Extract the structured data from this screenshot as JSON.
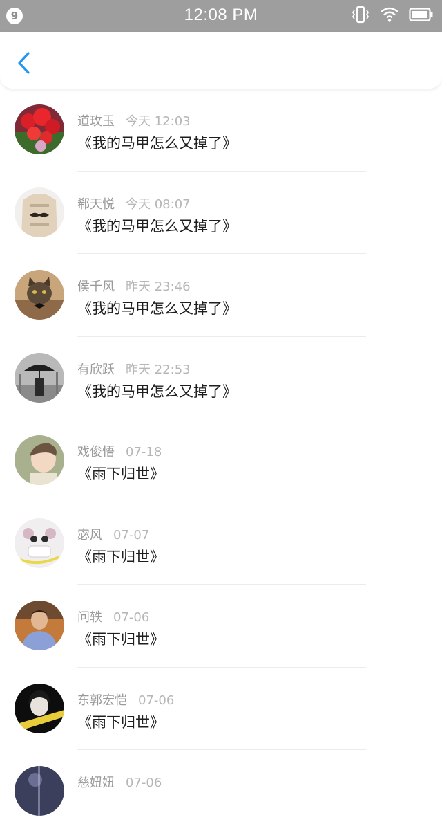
{
  "status_bar": {
    "notification_count": "9",
    "time": "12:08 PM"
  },
  "header": {
    "back_icon": "chevron-left-icon",
    "accent_color": "#2196f3"
  },
  "items": [
    {
      "name": "道玫玉",
      "time": "今天 12:03",
      "title": "《我的马甲怎么又掉了》"
    },
    {
      "name": "郗天悦",
      "time": "今天 08:07",
      "title": "《我的马甲怎么又掉了》"
    },
    {
      "name": "侯千风",
      "time": "昨天 23:46",
      "title": "《我的马甲怎么又掉了》"
    },
    {
      "name": "有欣跃",
      "time": "昨天 22:53",
      "title": "《我的马甲怎么又掉了》"
    },
    {
      "name": "戏俊悟",
      "time": "07-18",
      "title": "《雨下归世》"
    },
    {
      "name": "宓风",
      "time": "07-07",
      "title": "《雨下归世》"
    },
    {
      "name": "问轶",
      "time": "07-06",
      "title": "《雨下归世》"
    },
    {
      "name": "东郭宏恺",
      "time": "07-06",
      "title": "《雨下归世》"
    },
    {
      "name": "慈妞妞",
      "time": "07-06",
      "title": ""
    }
  ]
}
